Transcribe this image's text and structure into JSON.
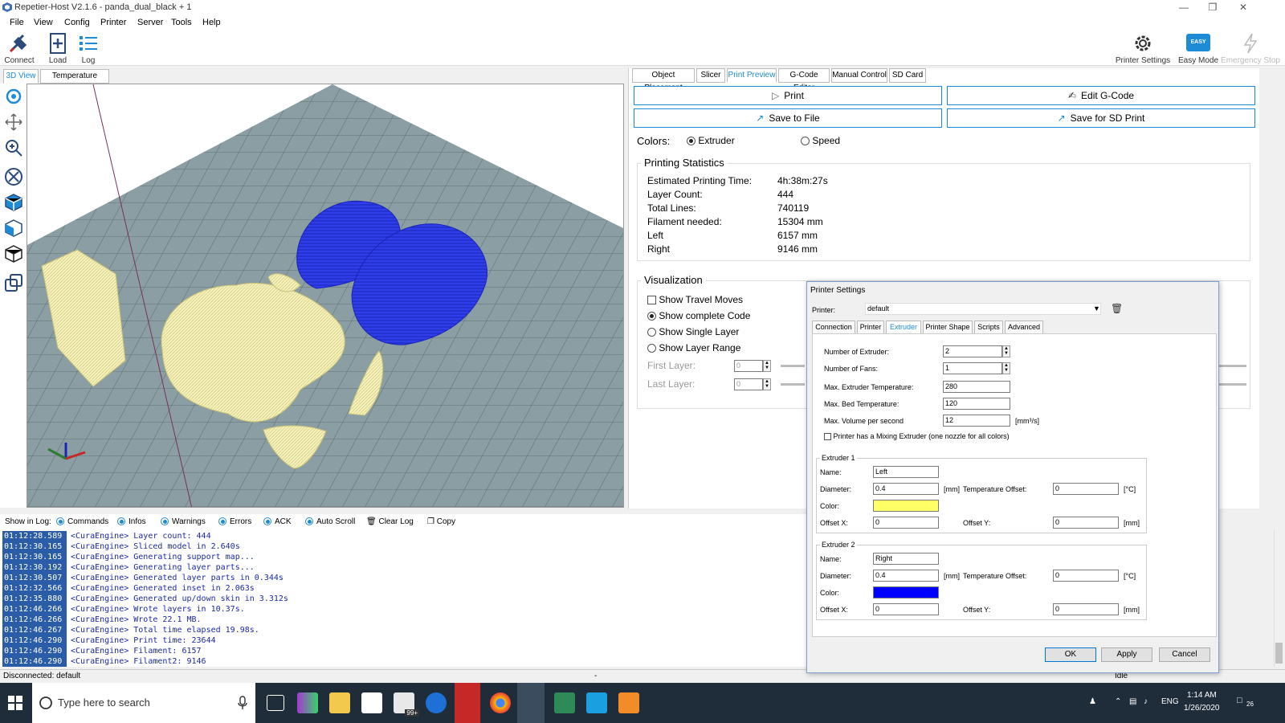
{
  "window": {
    "title": "Repetier-Host V2.1.6 - panda_dual_black + 1"
  },
  "menu": [
    "File",
    "View",
    "Config",
    "Printer",
    "Server",
    "Tools",
    "Help"
  ],
  "toolbar": {
    "connect": "Connect",
    "load": "Load",
    "log": "Log",
    "printer_settings": "Printer Settings",
    "easy_mode": "Easy Mode",
    "easy_badge": "EASY",
    "emergency_stop": "Emergency Stop"
  },
  "left_tabs": [
    "3D View",
    "Temperature Curve"
  ],
  "right_tabs": [
    "Object Placement",
    "Slicer",
    "Print Preview",
    "G-Code Editor",
    "Manual Control",
    "SD Card"
  ],
  "preview": {
    "print": "Print",
    "edit_gcode": "Edit G-Code",
    "save_file": "Save to File",
    "save_sd": "Save for SD Print",
    "colors_label": "Colors:",
    "color_extruder": "Extruder",
    "color_speed": "Speed"
  },
  "stats": {
    "title": "Printing Statistics",
    "rows": [
      {
        "label": "Estimated Printing Time:",
        "value": "4h:38m:27s"
      },
      {
        "label": "Layer Count:",
        "value": "444"
      },
      {
        "label": "Total Lines:",
        "value": "740119"
      },
      {
        "label": "Filament needed:",
        "value": "15304 mm"
      },
      {
        "label": "Left",
        "value": "6157 mm"
      },
      {
        "label": "Right",
        "value": "9146 mm"
      }
    ]
  },
  "visualization": {
    "title": "Visualization",
    "travel": "Show Travel Moves",
    "complete": "Show complete Code",
    "single": "Show Single Layer",
    "range": "Show Layer Range",
    "first_layer": "First Layer:",
    "last_layer": "Last Layer:",
    "first_val": "0",
    "last_val": "0"
  },
  "log": {
    "show_in_log": "Show in Log:",
    "options": [
      "Commands",
      "Infos",
      "Warnings",
      "Errors",
      "ACK",
      "Auto Scroll"
    ],
    "clear": "Clear Log",
    "copy": "Copy",
    "lines": [
      {
        "time": "01:12:28.589",
        "msg": "<CuraEngine> Layer count: 444"
      },
      {
        "time": "01:12:30.165",
        "msg": "<CuraEngine> Sliced model in 2.640s"
      },
      {
        "time": "01:12:30.165",
        "msg": "<CuraEngine> Generating support map..."
      },
      {
        "time": "01:12:30.192",
        "msg": "<CuraEngine> Generating layer parts..."
      },
      {
        "time": "01:12:30.507",
        "msg": "<CuraEngine> Generated layer parts in 0.344s"
      },
      {
        "time": "01:12:32.566",
        "msg": "<CuraEngine> Generated inset in 2.063s"
      },
      {
        "time": "01:12:35.880",
        "msg": "<CuraEngine> Generated up/down skin in 3.312s"
      },
      {
        "time": "01:12:46.266",
        "msg": "<CuraEngine> Wrote layers in 10.37s."
      },
      {
        "time": "01:12:46.266",
        "msg": "<CuraEngine> Wrote  22.1 MB."
      },
      {
        "time": "01:12:46.267",
        "msg": "<CuraEngine> Total time elapsed 19.98s."
      },
      {
        "time": "01:12:46.290",
        "msg": "<CuraEngine> Print time: 23644"
      },
      {
        "time": "01:12:46.290",
        "msg": "<CuraEngine> Filament: 6157"
      },
      {
        "time": "01:12:46.290",
        "msg": "<CuraEngine> Filament2: 9146"
      }
    ]
  },
  "status": {
    "left": "Disconnected: default",
    "mid": "-",
    "right": "Idle"
  },
  "dialog": {
    "title": "Printer Settings",
    "printer_label": "Printer:",
    "printer_value": "default",
    "tabs": [
      "Connection",
      "Printer",
      "Extruder",
      "Printer Shape",
      "Scripts",
      "Advanced"
    ],
    "num_extruder_label": "Number of Extruder:",
    "num_extruder": "2",
    "num_fans_label": "Number of Fans:",
    "num_fans": "1",
    "max_ext_temp_label": "Max. Extruder Temperature:",
    "max_ext_temp": "280",
    "max_bed_temp_label": "Max. Bed Temperature:",
    "max_bed_temp": "120",
    "max_vol_label": "Max. Volume per second",
    "max_vol": "12",
    "max_vol_unit": "[mm³/s]",
    "mixing_label": "Printer has a Mixing Extruder (one nozzle for all colors)",
    "ext1": {
      "title": "Extruder 1",
      "name_label": "Name:",
      "name": "Left",
      "diameter_label": "Diameter:",
      "diameter": "0.4",
      "mm": "[mm]",
      "temp_offset_label": "Temperature Offset:",
      "temp_offset": "0",
      "degc": "[°C]",
      "color_label": "Color:",
      "color": "#ffff66",
      "offx_label": "Offset X:",
      "offx": "0",
      "offy_label": "Offset Y:",
      "offy": "0",
      "mm2": "[mm]"
    },
    "ext2": {
      "title": "Extruder 2",
      "name_label": "Name:",
      "name": "Right",
      "diameter_label": "Diameter:",
      "diameter": "0.4",
      "mm": "[mm]",
      "temp_offset_label": "Temperature Offset:",
      "temp_offset": "0",
      "degc": "[°C]",
      "color_label": "Color:",
      "color": "#0000ff",
      "offx_label": "Offset X:",
      "offx": "0",
      "offy_label": "Offset Y:",
      "offy": "0",
      "mm2": "[mm]"
    },
    "ok": "OK",
    "apply": "Apply",
    "cancel": "Cancel"
  },
  "taskbar": {
    "search_placeholder": "Type here to search",
    "time": "1:14 AM",
    "date": "1/26/2020",
    "lang": "ENG",
    "notif": "26",
    "mail_badge": "99+"
  },
  "colors": {
    "accent": "#1e8bd6",
    "left_extruder": "#ffff66",
    "right_extruder": "#0000ff",
    "bed": "#8a9ea3"
  }
}
